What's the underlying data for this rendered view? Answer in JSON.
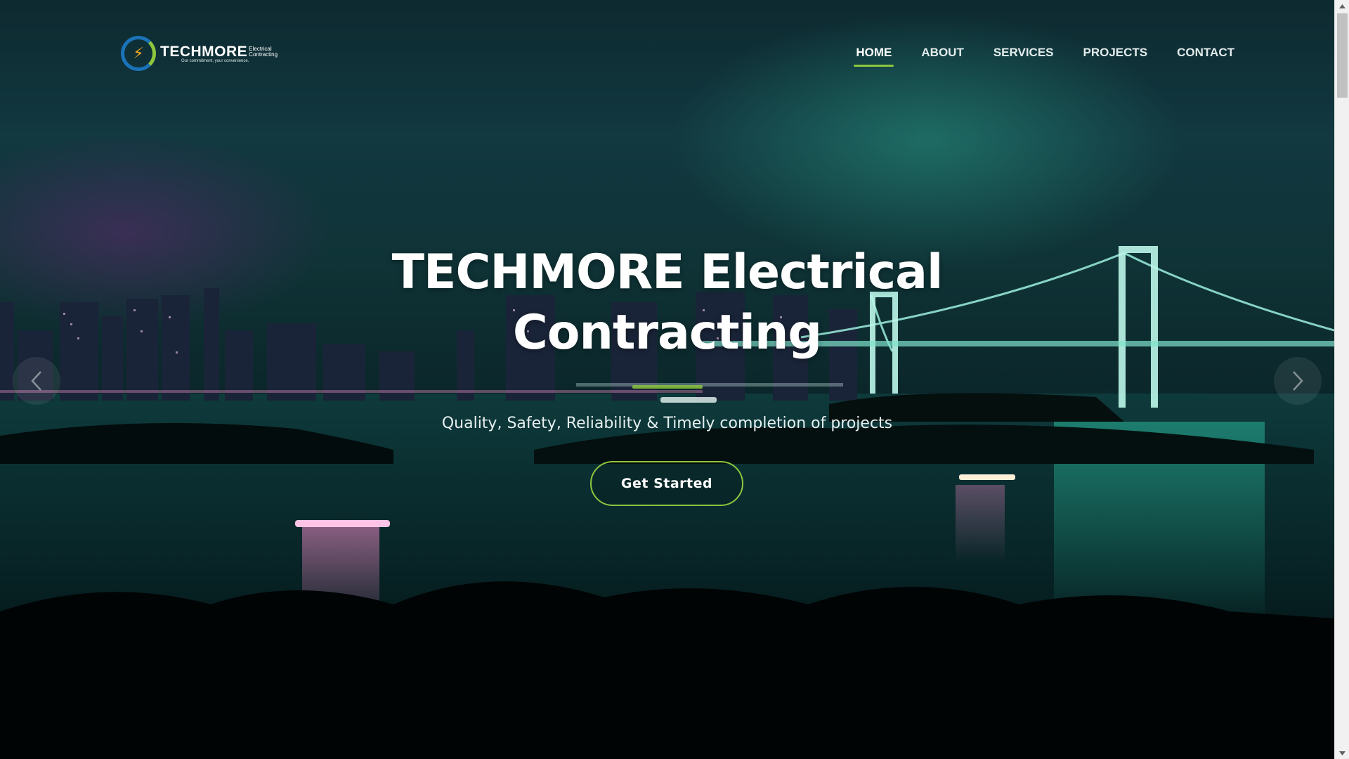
{
  "brand": {
    "name": "TECHMORE",
    "sub_line1": "Electrical",
    "sub_line2": "Contracting",
    "tagline": "Our commitment, your convenience.",
    "colors": {
      "accent": "#8cc63f",
      "blue": "#1a73b8",
      "bolt": "#f2a91f"
    }
  },
  "nav": {
    "items": [
      {
        "label": "HOME",
        "active": true
      },
      {
        "label": "ABOUT",
        "active": false
      },
      {
        "label": "SERVICES",
        "active": false
      },
      {
        "label": "PROJECTS",
        "active": false
      },
      {
        "label": "CONTACT",
        "active": false
      }
    ]
  },
  "hero": {
    "title_line1": "TECHMORE Electrical",
    "title_line2": "Contracting",
    "subtitle": "Quality, Safety, Reliability & Timely completion of projects",
    "cta_label": "Get Started",
    "prev_icon": "chevron-left-icon",
    "next_icon": "chevron-right-icon"
  }
}
